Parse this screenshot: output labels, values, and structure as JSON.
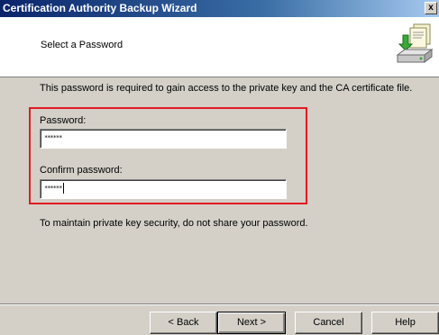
{
  "window": {
    "title": "Certification Authority Backup Wizard",
    "close_glyph": "x"
  },
  "header": {
    "title": "Select a Password",
    "icon": "backup-wizard-icon"
  },
  "main": {
    "intro": "This password is required to gain access to the private key and the CA certificate file.",
    "password_label": "Password:",
    "password_value": "******",
    "confirm_label": "Confirm password:",
    "confirm_value": "******",
    "note": "To maintain private key security, do not share your password.",
    "highlight_color": "#e21b23"
  },
  "buttons": {
    "back": "< Back",
    "next": "Next >",
    "cancel": "Cancel",
    "help": "Help"
  }
}
